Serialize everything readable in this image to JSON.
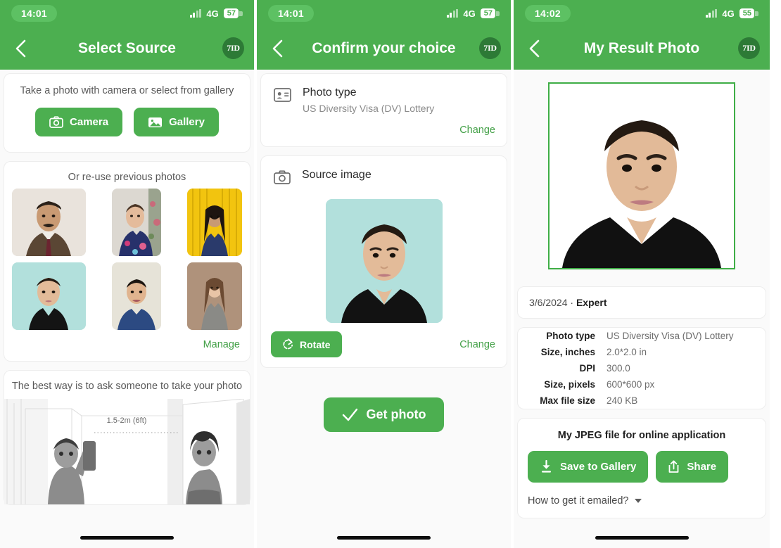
{
  "screen1": {
    "status": {
      "time": "14:01",
      "network": "4G",
      "battery": "57"
    },
    "nav": {
      "title": "Select Source",
      "logo": "7ID",
      "back_icon": "chevron-left-icon"
    },
    "source_card": {
      "hint": "Take a photo with camera or select from gallery",
      "camera_label": "Camera",
      "gallery_label": "Gallery"
    },
    "previous_card": {
      "title": "Or re-use previous photos",
      "manage_label": "Manage",
      "thumbs": [
        {
          "name": "thumb-man-suit",
          "bg": "#e9e3dc"
        },
        {
          "name": "thumb-woman-floral",
          "bg": "#d9d5ce"
        },
        {
          "name": "thumb-woman-yellow",
          "bg": "#f2c40f"
        },
        {
          "name": "thumb-woman-teal",
          "bg": "#b5e0dc"
        },
        {
          "name": "thumb-man-blue",
          "bg": "#e6e3d8"
        },
        {
          "name": "thumb-woman-brown",
          "bg": "#a98d76"
        }
      ]
    },
    "tips_card": {
      "title": "The best way is to ask someone to take your photo",
      "distance_label": "1.5-2m (6ft)"
    }
  },
  "screen2": {
    "status": {
      "time": "14:01",
      "network": "4G",
      "battery": "57"
    },
    "nav": {
      "title": "Confirm your choice",
      "logo": "7ID",
      "back_icon": "chevron-left-icon"
    },
    "photo_type_card": {
      "icon": "id-card-icon",
      "title": "Photo type",
      "value": "US Diversity Visa (DV) Lottery",
      "change_label": "Change"
    },
    "source_image_card": {
      "icon": "camera-icon",
      "title": "Source image",
      "rotate_label": "Rotate",
      "change_label": "Change"
    },
    "get_photo_label": "Get photo"
  },
  "screen3": {
    "status": {
      "time": "14:02",
      "network": "4G",
      "battery": "55"
    },
    "nav": {
      "title": "My Result Photo",
      "logo": "7ID",
      "back_icon": "chevron-left-icon"
    },
    "meta": {
      "date": "3/6/2024",
      "separator": "·",
      "plan": "Expert"
    },
    "specs": [
      {
        "key": "Photo type",
        "value": "US Diversity Visa (DV) Lottery"
      },
      {
        "key": "Size, inches",
        "value": "2.0*2.0 in"
      },
      {
        "key": "DPI",
        "value": "300.0"
      },
      {
        "key": "Size, pixels",
        "value": "600*600 px"
      },
      {
        "key": "Max file size",
        "value": "240 KB"
      }
    ],
    "file_card": {
      "title": "My JPEG file for online application",
      "save_label": "Save to Gallery",
      "share_label": "Share",
      "emailed_label": "How to get it emailed?"
    }
  },
  "colors": {
    "brand_green": "#4caf50",
    "dark_green_badge": "#2d7a36",
    "link_green": "#43a047",
    "result_border": "#3fae46",
    "page_bg": "#fafafa"
  }
}
